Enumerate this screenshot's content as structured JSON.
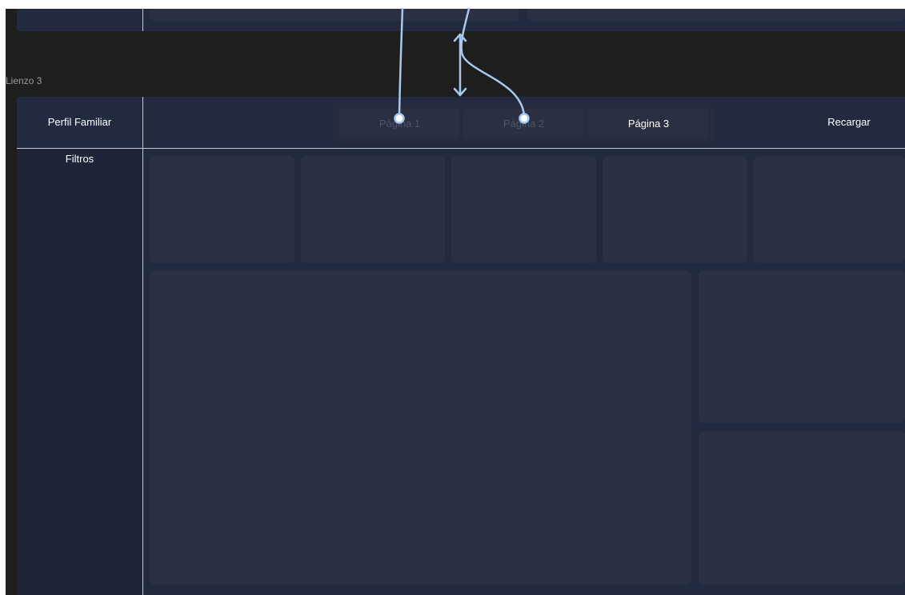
{
  "canvas": {
    "label": "Lienzo 3",
    "title": "Perfil Familiar",
    "filters_label": "Filtros",
    "tabs": [
      {
        "label": "Página 1",
        "state": "inactive"
      },
      {
        "label": "Página 2",
        "state": "inactive"
      },
      {
        "label": "Página 3",
        "state": "active"
      }
    ],
    "reload_label": "Recargar"
  },
  "colors": {
    "workspace_bg": "#1e1e1e",
    "canvas_bg": "#222a40",
    "sidebar_bg": "#1f2538",
    "card_bg": "#2b3042",
    "inactive_tab_text": "#4d5466",
    "active_tab_text": "#ffffff",
    "connector": "#a8c8ee"
  },
  "icons": [
    "connector-arrow",
    "navigation-dot-handle",
    "double-arrow-icon"
  ]
}
